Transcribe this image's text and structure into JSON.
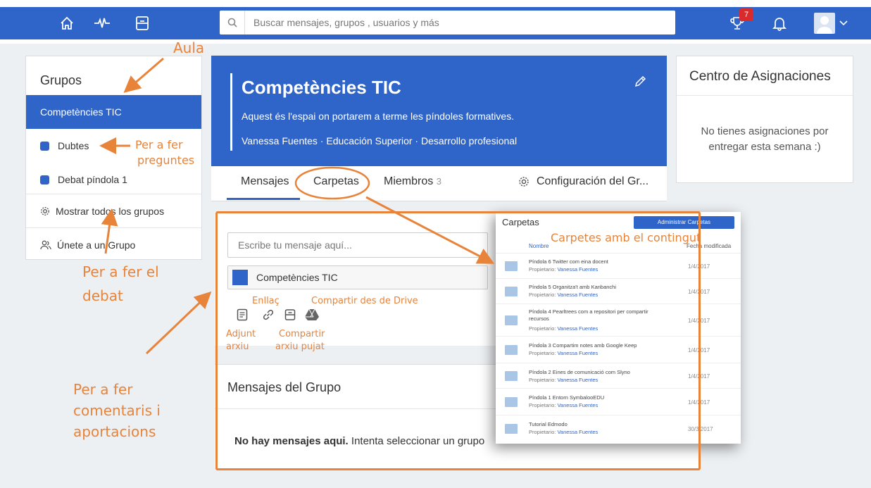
{
  "search": {
    "placeholder": "Buscar mensajes, grupos , usuarios y más"
  },
  "topbar": {
    "notification_count": "7"
  },
  "groups": {
    "title": "Grupos",
    "items": [
      {
        "label": "Competències TIC"
      },
      {
        "label": "Dubtes"
      },
      {
        "label": "Debat píndola 1"
      },
      {
        "label": "Mostrar todos los grupos"
      },
      {
        "label": "Únete a un Grupo"
      }
    ]
  },
  "group_header": {
    "title": "Competències TIC",
    "description": "Aquest és l'espai on portarem a terme les píndoles formatives.",
    "meta": "Vanessa Fuentes · Educación Superior · Desarrollo profesional"
  },
  "tabs": {
    "messages": "Mensajes",
    "folders": "Carpetas",
    "members": "Miembros",
    "members_count": "3",
    "settings": "Configuración del Gr..."
  },
  "composer": {
    "placeholder": "Escribe tu mensaje aquí...",
    "selected_group": "Competències TIC"
  },
  "messages": {
    "title": "Mensajes del Grupo",
    "empty_bold": "No hay mensajes aqui.",
    "empty_rest": " Intenta seleccionar un grupo"
  },
  "assignments": {
    "title": "Centro de Asignaciones",
    "empty": "No tienes asignaciones por entregar esta semana :)"
  },
  "folders": {
    "title": "Carpetas",
    "admin_button": "Administrar Carpetas",
    "col_name": "Nombre",
    "col_date": "Fecha modificada",
    "owner_label": "Propietario:",
    "rows": [
      {
        "name": "Píndola 6 Twitter com eina docent",
        "owner": "Vanessa Fuentes",
        "date": "1/4/2017"
      },
      {
        "name": "Píndola 5 Organitza't amb Kanbanchi",
        "owner": "Vanessa Fuentes",
        "date": "1/4/2017"
      },
      {
        "name": "Píndola 4 Pearltrees com a repositori per compartir recursos",
        "owner": "Vanessa Fuentes",
        "date": "1/4/2017"
      },
      {
        "name": "Píndola 3 Compartim notes amb Google Keep",
        "owner": "Vanessa Fuentes",
        "date": "1/4/2017"
      },
      {
        "name": "Píndola 2 Eines de comunicació com Slyno",
        "owner": "Vanessa Fuentes",
        "date": "1/4/2017"
      },
      {
        "name": "Píndola 1 Entorn SymbalooEDU",
        "owner": "Vanessa Fuentes",
        "date": "1/4/2017"
      },
      {
        "name": "Tutorial Edmodo",
        "owner": "Vanessa Fuentes",
        "date": "30/3/2017"
      }
    ]
  },
  "annotations": {
    "aula": "Aula",
    "preguntes_1": "Per a fer",
    "preguntes_2": "preguntes",
    "debat_1": "Per a fer el",
    "debat_2": "debat",
    "comentaris_1": "Per a fer",
    "comentaris_2": "comentaris i",
    "comentaris_3": "aportacions",
    "carpetes": "Carpetes amb el contingut",
    "enllac": "Enllaç",
    "drive": "Compartir des de Drive",
    "adjunt_1": "Adjunt",
    "adjunt_2": "arxiu",
    "pujat_1": "Compartir",
    "pujat_2": "arxiu pujat"
  },
  "colors": {
    "primary": "#2f64c8",
    "annotation": "#e8833a",
    "badge": "#d92b2b"
  }
}
